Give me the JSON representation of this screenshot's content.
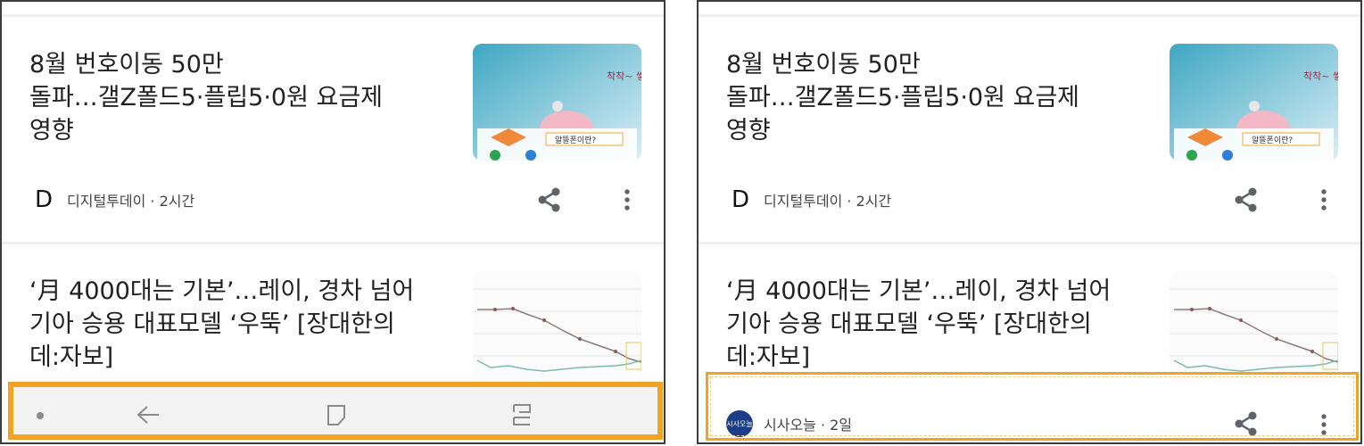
{
  "articles": [
    {
      "title_lines": [
        "8월 번호이동 50만",
        "돌파…갤Z폴드5·플립5·0원 요금제",
        "영향"
      ],
      "source": "디지털투데이 · 2시간",
      "source_logo_letter": "D",
      "thumb_text": {
        "top": "착착~ 쌓이는 것이",
        "badge": "알뜰폰이란?"
      }
    },
    {
      "title_lines": [
        "‘月 4000대는 기본’…레이, 경차 넘어",
        "기아 승용 대표모델 ‘우뚝’ [장대한의",
        "데:자보]"
      ],
      "source": "시사오늘 · 2일",
      "source_logo_text": "시사오늘"
    }
  ],
  "nav_bar": {
    "buttons": [
      "dot-icon",
      "back-icon",
      "home-icon",
      "recents-icon"
    ]
  },
  "colors": {
    "highlight": "#f2a322",
    "nav_bg": "#f3f3f3",
    "icon_gray": "#5f6368"
  }
}
